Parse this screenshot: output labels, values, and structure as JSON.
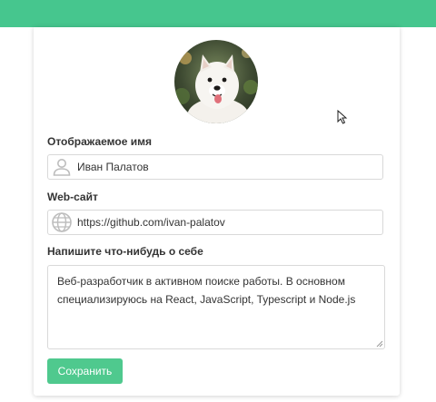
{
  "colors": {
    "accent": "#46c68e",
    "button": "#4fc98e",
    "icon_gray": "#bdbdbd"
  },
  "profile": {
    "avatar_icon": "dog-avatar",
    "display_name": {
      "label": "Отображаемое имя",
      "icon": "user-icon",
      "value": "Иван Палатов"
    },
    "website": {
      "label": "Web-сайт",
      "icon": "globe-icon",
      "value": "https://github.com/ivan-palatov"
    },
    "about": {
      "label": "Напишите что-нибудь о себе",
      "value": "Веб-разработчик в активном поиске работы. В основном специализируюсь на React, JavaScript, Typescript и Node.js"
    },
    "save_button": "Сохранить"
  }
}
